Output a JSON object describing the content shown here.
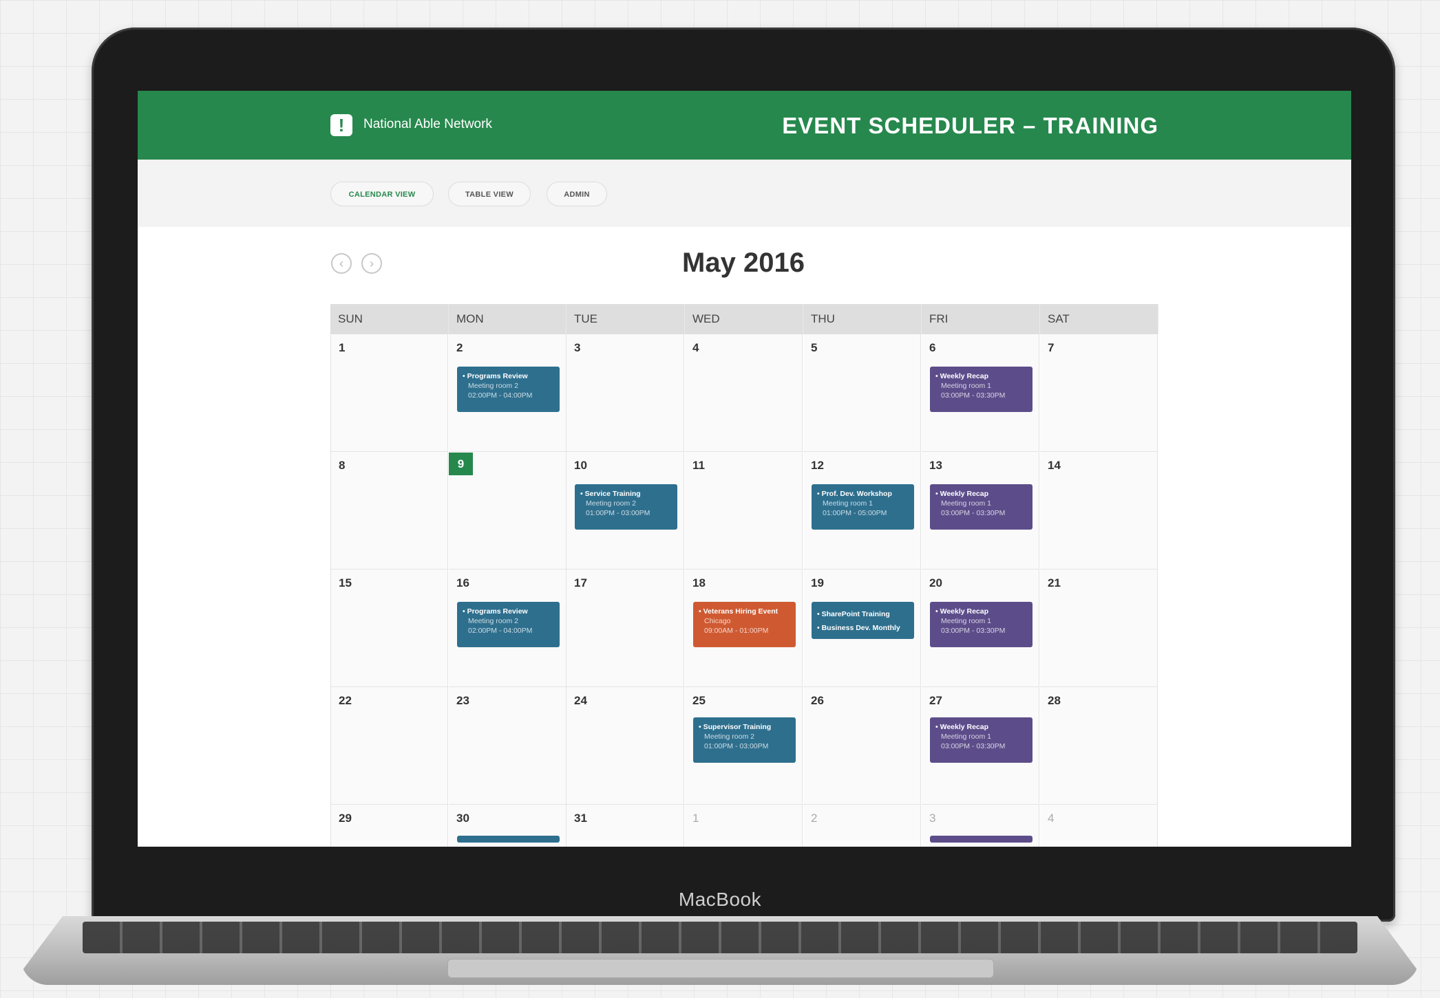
{
  "device": {
    "label": "MacBook"
  },
  "header": {
    "logo_glyph": "!",
    "org_name": "National Able Network",
    "app_title": "EVENT SCHEDULER – TRAINING",
    "color": "#26884d"
  },
  "tabs": [
    {
      "label": "CALENDAR VIEW",
      "active": true
    },
    {
      "label": "TABLE VIEW",
      "active": false
    },
    {
      "label": "ADMIN",
      "active": false
    }
  ],
  "calendar": {
    "month_label": "May 2016",
    "nav": {
      "prev_icon": "chevron-left-icon",
      "next_icon": "chevron-right-icon",
      "prev_glyph": "‹",
      "next_glyph": "›"
    },
    "weekdays": [
      "SUN",
      "MON",
      "TUE",
      "WED",
      "THU",
      "FRI",
      "SAT"
    ],
    "today": "9",
    "weeks": [
      [
        "1",
        "2",
        "3",
        "4",
        "5",
        "6",
        "7"
      ],
      [
        "8",
        "9",
        "10",
        "11",
        "12",
        "13",
        "14"
      ],
      [
        "15",
        "16",
        "17",
        "18",
        "19",
        "20",
        "21"
      ],
      [
        "22",
        "23",
        "24",
        "25",
        "26",
        "27",
        "28"
      ],
      [
        "29",
        "30",
        "31",
        "1",
        "2",
        "3",
        "4"
      ]
    ],
    "events": {
      "w0_mon": {
        "title": "• Programs Review",
        "line1": "Meeting room 2",
        "line2": "02:00PM - 04:00PM",
        "color": "#2e6f8e"
      },
      "w0_fri": {
        "title": "• Weekly Recap",
        "line1": "Meeting room 1",
        "line2": "03:00PM - 03:30PM",
        "color": "#5c4d8a"
      },
      "w1_tue": {
        "title": "• Service Training",
        "line1": "Meeting room 2",
        "line2": "01:00PM - 03:00PM",
        "color": "#2e6f8e"
      },
      "w1_thu": {
        "title": "• Prof. Dev. Workshop",
        "line1": "Meeting room 1",
        "line2": "01:00PM - 05:00PM",
        "color": "#2e6f8e"
      },
      "w1_fri": {
        "title": "• Weekly Recap",
        "line1": "Meeting room 1",
        "line2": "03:00PM - 03:30PM",
        "color": "#5c4d8a"
      },
      "w2_mon": {
        "title": "• Programs Review",
        "line1": "Meeting room 2",
        "line2": "02:00PM - 04:00PM",
        "color": "#2e6f8e"
      },
      "w2_wed": {
        "title": "• Veterans Hiring Event",
        "line1": "Chicago",
        "line2": "09:00AM - 01:00PM",
        "color": "#cf5a32"
      },
      "w2_thu": {
        "title": "• SharePoint Training",
        "title2": "• Business Dev. Monthly",
        "color": "#2e6f8e"
      },
      "w2_fri": {
        "title": "• Weekly Recap",
        "line1": "Meeting room 1",
        "line2": "03:00PM - 03:30PM",
        "color": "#5c4d8a"
      },
      "w3_wed": {
        "title": "• Supervisor Training",
        "line1": "Meeting room 2",
        "line2": "01:00PM - 03:00PM",
        "color": "#2e6f8e"
      },
      "w3_fri": {
        "title": "• Weekly Recap",
        "line1": "Meeting room 1",
        "line2": "03:00PM - 03:30PM",
        "color": "#5c4d8a"
      }
    }
  }
}
